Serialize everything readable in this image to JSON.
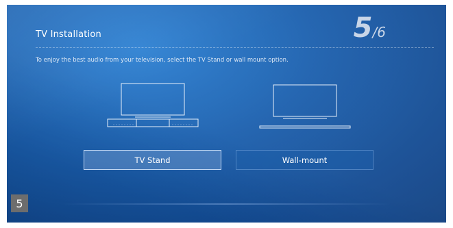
{
  "header": {
    "title": "TV Installation",
    "step_current": "5",
    "step_separator": "/",
    "step_total": "6"
  },
  "subtitle": "To enjoy the best audio from your television, select the TV Stand or wall mount option.",
  "options": {
    "stand_icon": "tv-on-soundbar-icon",
    "wall_icon": "wall-mounted-tv-icon",
    "stand_label": "TV Stand",
    "wall_label": "Wall-mount",
    "selected": "TV Stand"
  },
  "page_badge": "5",
  "colors": {
    "background": "#1a5fae",
    "selected_button": "#7aa0d2",
    "badge": "#6d6d6d"
  }
}
